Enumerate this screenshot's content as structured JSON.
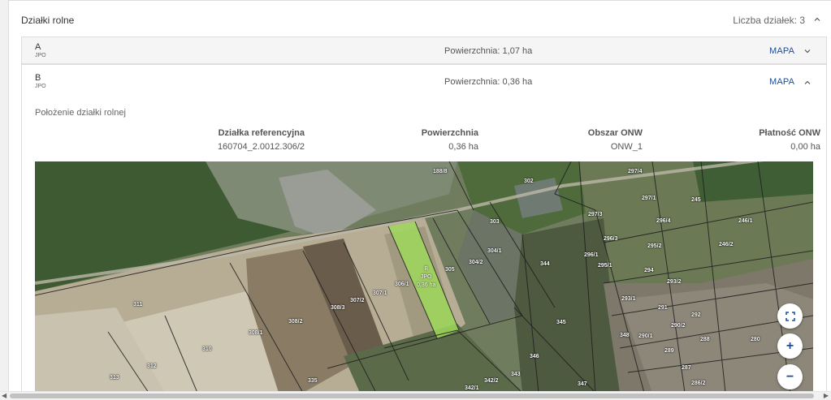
{
  "header": {
    "title": "Działki rolne",
    "count_label": "Liczba działek: 3"
  },
  "plots": [
    {
      "letter": "A",
      "sub": "JPO",
      "area": "Powierzchnia: 1,07 ha",
      "map_label": "MAPA",
      "expanded": false
    },
    {
      "letter": "B",
      "sub": "JPO",
      "area": "Powierzchnia: 0,36 ha",
      "map_label": "MAPA",
      "expanded": true
    }
  ],
  "details": {
    "section_title": "Położenie działki rolnej",
    "columns": [
      {
        "header": "Działka referencyjna",
        "value": "160704_2.0012.306/2"
      },
      {
        "header": "Powierzchnia",
        "value": "0,36 ha"
      },
      {
        "header": "Obszar ONW",
        "value": "ONW_1"
      },
      {
        "header": "Płatność ONW",
        "value": "0,00 ha"
      }
    ]
  },
  "map": {
    "plot_label": {
      "letter": "B",
      "code": "JPO",
      "area": "0,36 ha"
    },
    "parcel_labels": [
      "188/8",
      "302",
      "297/4",
      "297/1",
      "245",
      "297/3",
      "296/4",
      "246/1",
      "303",
      "296/3",
      "295/2",
      "246/2",
      "304/1",
      "296/1",
      "295/1",
      "344",
      "305",
      "304/2",
      "306/1",
      "294",
      "293/2",
      "307/1",
      "293/1",
      "311",
      "307/2",
      "308/3",
      "291",
      "292",
      "345",
      "308/2",
      "290/2",
      "308/1",
      "348",
      "290/1",
      "288",
      "280",
      "310",
      "289",
      "346",
      "312",
      "287",
      "313",
      "343",
      "335",
      "342/2",
      "286/2",
      "347",
      "342/1"
    ],
    "buttons": {
      "fullscreen": "fullscreen-icon",
      "zoom_in": "+",
      "zoom_out": "−"
    },
    "colors": {
      "highlight": "#9ed85a",
      "road": "#bdb8a8"
    }
  }
}
